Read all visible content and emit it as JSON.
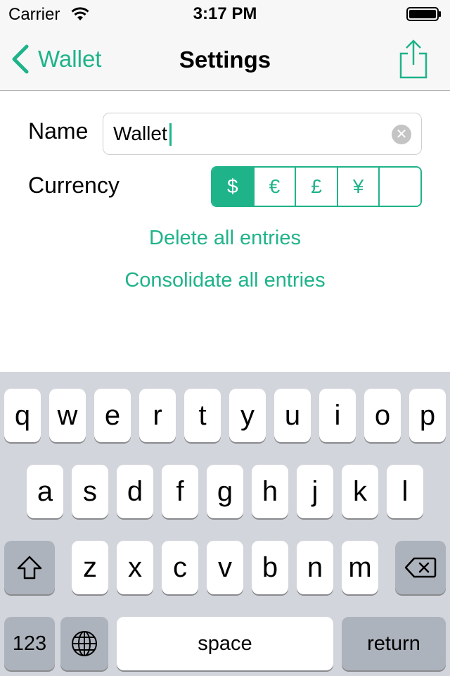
{
  "status_bar": {
    "carrier": "Carrier",
    "time": "3:17 PM",
    "icons": [
      "wifi-icon",
      "battery-icon"
    ]
  },
  "nav": {
    "back_label": "Wallet",
    "title": "Settings",
    "share_icon": "share-icon"
  },
  "form": {
    "name_label": "Name",
    "name_value": "Wallet",
    "clear_icon": "clear-text-icon",
    "currency_label": "Currency",
    "currency_options": [
      "$",
      "€",
      "£",
      "¥",
      ""
    ],
    "currency_selected": "$"
  },
  "actions": {
    "delete_label": "Delete all entries",
    "consolidate_label": "Consolidate all entries"
  },
  "keyboard": {
    "row1": [
      "q",
      "w",
      "e",
      "r",
      "t",
      "y",
      "u",
      "i",
      "o",
      "p"
    ],
    "row2": [
      "a",
      "s",
      "d",
      "f",
      "g",
      "h",
      "j",
      "k",
      "l"
    ],
    "row3": [
      "z",
      "x",
      "c",
      "v",
      "b",
      "n",
      "m"
    ],
    "numbers_label": "123",
    "space_label": "space",
    "return_label": "return",
    "icons": [
      "shift-icon",
      "delete-icon",
      "globe-icon"
    ]
  },
  "colors": {
    "accent": "#1fb38a",
    "keyboard_bg": "#d2d5db",
    "special_key": "#adb3bc"
  }
}
